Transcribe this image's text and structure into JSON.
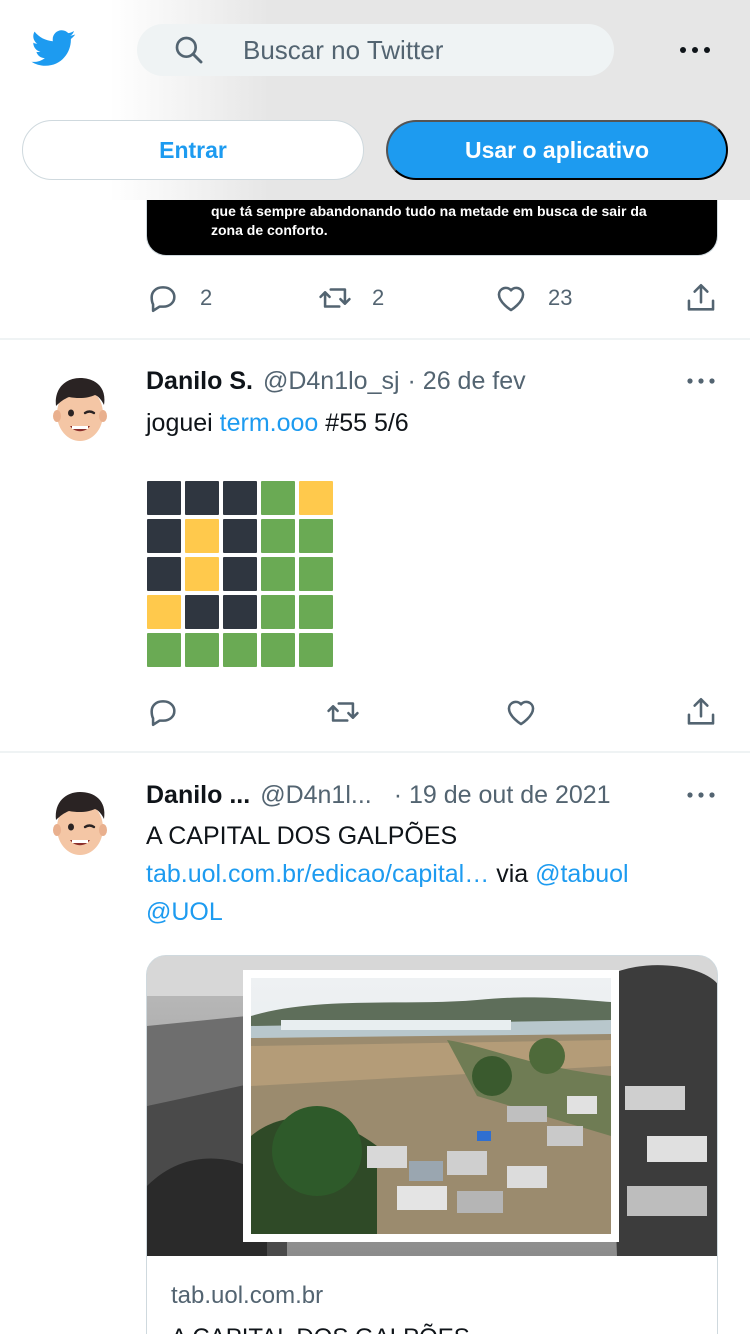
{
  "header": {
    "search_placeholder": "Buscar no Twitter",
    "login_label": "Entrar",
    "app_label": "Usar o aplicativo"
  },
  "prev_tweet": {
    "image_caption": "que tá sempre abandonando tudo na metade em busca de sair da zona de conforto.",
    "replies": "2",
    "retweets": "2",
    "likes": "23"
  },
  "tweets": [
    {
      "author": "Danilo S.",
      "handle": "@D4n1lo_sj",
      "date": "· 26 de fev",
      "text_prefix": "joguei ",
      "link": "term.ooo",
      "text_suffix": " #55 5/6",
      "wordle": [
        [
          "d",
          "d",
          "d",
          "g",
          "y"
        ],
        [
          "d",
          "y",
          "d",
          "g",
          "g"
        ],
        [
          "d",
          "y",
          "d",
          "g",
          "g"
        ],
        [
          "y",
          "d",
          "d",
          "g",
          "g"
        ],
        [
          "g",
          "g",
          "g",
          "g",
          "g"
        ]
      ]
    },
    {
      "author": "Danilo ...",
      "handle": "@D4n1l...",
      "date": "· 19 de out de 2021",
      "text_line1": "A CAPITAL DOS GALPÕES",
      "link": "tab.uol.com.br/edicao/capital…",
      "via": " via ",
      "mention1": "@tabuol",
      "mention2": "@UOL",
      "card_domain": "tab.uol.com.br",
      "card_title": "A CAPITAL DOS GALPÕES"
    }
  ],
  "colors": {
    "accent": "#1d9bf0",
    "wordle_dark": "#2f3640",
    "wordle_yellow": "#ffc94c",
    "wordle_green": "#6aaa54",
    "muted_text": "#536471"
  },
  "icons": [
    "twitter-logo-icon",
    "search-icon",
    "more-icon",
    "reply-icon",
    "retweet-icon",
    "like-icon",
    "share-icon"
  ]
}
